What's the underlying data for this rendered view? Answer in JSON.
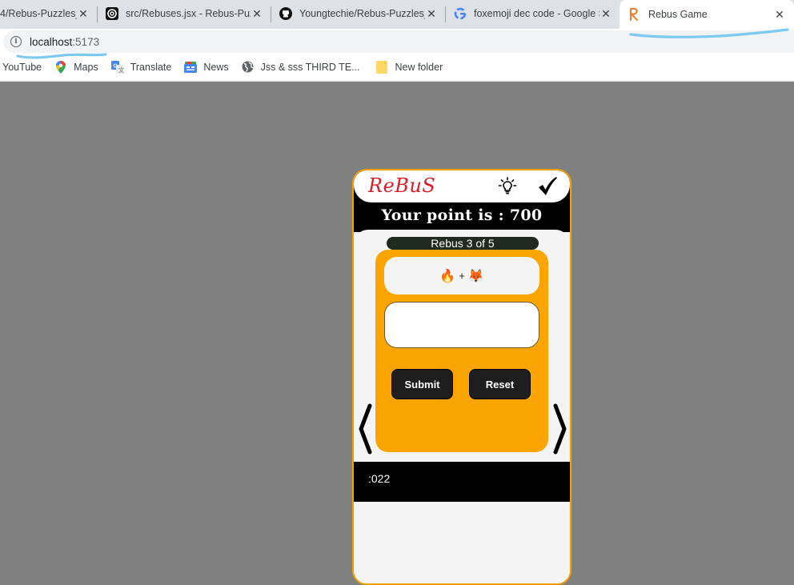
{
  "browser": {
    "tabs": [
      {
        "title": "4/Rebus-Puzzles_",
        "favicon": "github-icon",
        "active": false
      },
      {
        "title": "src/Rebuses.jsx - Rebus-Puzzl",
        "favicon": "codesandbox-icon",
        "active": false
      },
      {
        "title": "Youngtechie/Rebus-Puzzles_",
        "favicon": "github-icon",
        "active": false
      },
      {
        "title": "foxemoji dec code - Google S",
        "favicon": "google-icon",
        "active": false
      },
      {
        "title": "Rebus Game",
        "favicon": "rebus-r-icon",
        "active": true
      }
    ],
    "close_glyph": "✕",
    "address_bar": {
      "host": "localhost",
      "port": ":5173",
      "info_glyph": "i"
    },
    "bookmarks": [
      {
        "label": "YouTube",
        "icon": "none"
      },
      {
        "label": "Maps",
        "icon": "maps-pin-icon"
      },
      {
        "label": "Translate",
        "icon": "translate-icon"
      },
      {
        "label": "News",
        "icon": "news-icon"
      },
      {
        "label": "Jss & sss THIRD TE...",
        "icon": "globe-icon"
      },
      {
        "label": "New folder",
        "icon": "folder-icon"
      }
    ]
  },
  "game": {
    "logo": "ReBuS",
    "points_text": "Your point is : 700",
    "points": 700,
    "progress_label": "Rebus 3 of 5",
    "current": 3,
    "total": 5,
    "puzzle": {
      "first_emoji": "🔥",
      "operator": "+",
      "second_emoji": "🦊"
    },
    "answer": {
      "value": "",
      "placeholder": ""
    },
    "buttons": {
      "submit": "Submit",
      "reset": "Reset"
    },
    "footer_text": ":022",
    "colors": {
      "accent_orange": "#fca500",
      "card_border": "#f2a000",
      "logo_red": "#d81e2a",
      "pill_dark": "#1f2b1f",
      "button_dark": "#1e1e1e"
    }
  }
}
